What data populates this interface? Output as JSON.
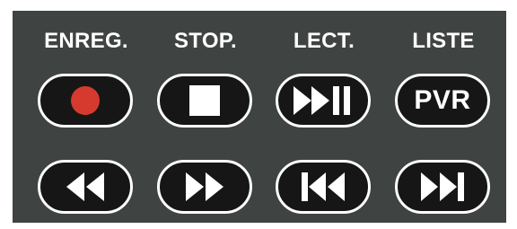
{
  "remote": {
    "labels": {
      "record": "ENREG.",
      "stop": "STOP.",
      "play": "LECT.",
      "list": "LISTE"
    },
    "buttons": {
      "record_icon": "record-dot-icon",
      "stop_icon": "stop-square-icon",
      "play_pause_icon": "play-pause-icon",
      "pvr_text": "PVR",
      "rewind_icon": "rewind-icon",
      "fast_forward_icon": "fast-forward-icon",
      "skip_back_icon": "skip-previous-icon",
      "skip_forward_icon": "skip-next-icon"
    },
    "colors": {
      "panel_background": "#3f4341",
      "button_fill": "#161616",
      "button_outline": "#ffffff",
      "record_dot": "#d63a2f",
      "label_text": "#ffffff"
    }
  }
}
